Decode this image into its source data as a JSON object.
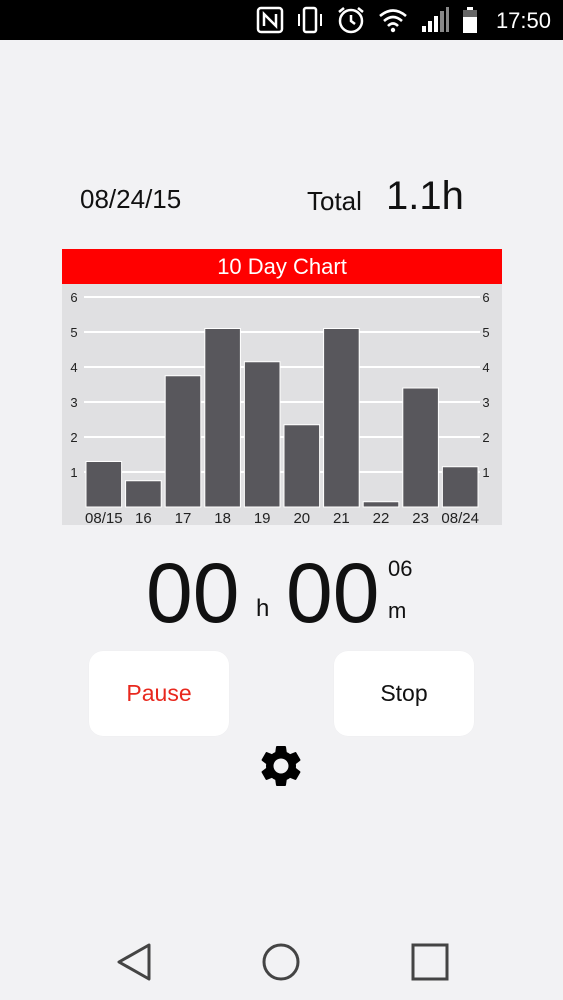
{
  "status_bar": {
    "time": "17:50",
    "icons": [
      "nfc-icon",
      "vibrate-icon",
      "alarm-icon",
      "wifi-icon",
      "signal-icon",
      "battery-icon"
    ]
  },
  "summary": {
    "date": "08/24/15",
    "total_label": "Total",
    "total_value": "1.1h"
  },
  "chart_data": {
    "type": "bar",
    "title": "10 Day Chart",
    "categories": [
      "08/15",
      "16",
      "17",
      "18",
      "19",
      "20",
      "21",
      "22",
      "23",
      "08/24"
    ],
    "values": [
      1.3,
      0.75,
      3.75,
      5.1,
      4.15,
      2.35,
      5.1,
      0.15,
      3.4,
      1.15
    ],
    "ylim": [
      0,
      6
    ],
    "yticks": [
      1,
      2,
      3,
      4,
      5,
      6
    ],
    "grid": true,
    "colors": {
      "bar": "#58575c",
      "title_bg": "#ff0000",
      "plot_bg": "#e0e0e2",
      "grid": "#ffffff"
    }
  },
  "timer": {
    "hours": "00",
    "hours_unit": "h",
    "minutes": "00",
    "seconds": "06",
    "minutes_unit": "m"
  },
  "buttons": {
    "pause_label": "Pause",
    "stop_label": "Stop"
  },
  "settings_icon": "gear-icon",
  "nav_bar": [
    "back-icon",
    "home-icon",
    "recents-icon"
  ]
}
